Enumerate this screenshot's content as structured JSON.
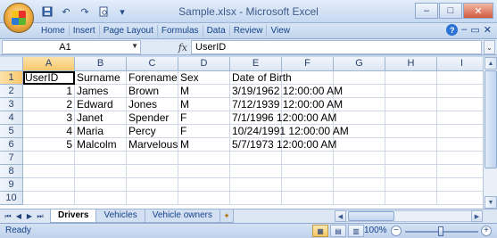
{
  "title_bar": {
    "title": "Sample.xlsx - Microsoft Excel",
    "minimize_label": "–",
    "maximize_label": "□",
    "close_label": "✕"
  },
  "ribbon": {
    "tabs": [
      "Home",
      "Insert",
      "Page Layout",
      "Formulas",
      "Data",
      "Review",
      "View"
    ]
  },
  "formula_bar": {
    "name_box": "A1",
    "fx_label": "fx",
    "content": "UserID"
  },
  "columns": [
    "A",
    "B",
    "C",
    "D",
    "E",
    "F",
    "G",
    "H",
    "I"
  ],
  "rows": [
    "1",
    "2",
    "3",
    "4",
    "5",
    "6",
    "7",
    "8",
    "9",
    "10"
  ],
  "cells": [
    [
      "UserID",
      "Surname",
      "Forename",
      "Sex",
      "Date of Birth",
      "",
      "",
      "",
      ""
    ],
    [
      "1",
      "James",
      "Brown",
      "M",
      "3/19/1962 12:00:00 AM",
      "",
      "",
      "",
      ""
    ],
    [
      "2",
      "Edward",
      "Jones",
      "M",
      "7/12/1939 12:00:00 AM",
      "",
      "",
      "",
      ""
    ],
    [
      "3",
      "Janet",
      "Spender",
      "F",
      "7/1/1996 12:00:00 AM",
      "",
      "",
      "",
      ""
    ],
    [
      "4",
      "Maria",
      "Percy",
      "F",
      "10/24/1991 12:00:00 AM",
      "",
      "",
      "",
      ""
    ],
    [
      "5",
      "Malcolm",
      "Marvelous",
      "M",
      "5/7/1973 12:00:00 AM",
      "",
      "",
      "",
      ""
    ],
    [
      "",
      "",
      "",
      "",
      "",
      "",
      "",
      "",
      ""
    ],
    [
      "",
      "",
      "",
      "",
      "",
      "",
      "",
      "",
      ""
    ],
    [
      "",
      "",
      "",
      "",
      "",
      "",
      "",
      "",
      ""
    ],
    [
      "",
      "",
      "",
      "",
      "",
      "",
      "",
      "",
      ""
    ]
  ],
  "sheets": {
    "tabs": [
      "Drivers",
      "Vehicles",
      "Vehicle owners"
    ],
    "active": "Drivers"
  },
  "status_bar": {
    "status": "Ready",
    "zoom": "100%",
    "zoom_level_percent": 100
  },
  "colors": {
    "active_header": "#f8c86d",
    "ribbon_text": "#15428b"
  }
}
